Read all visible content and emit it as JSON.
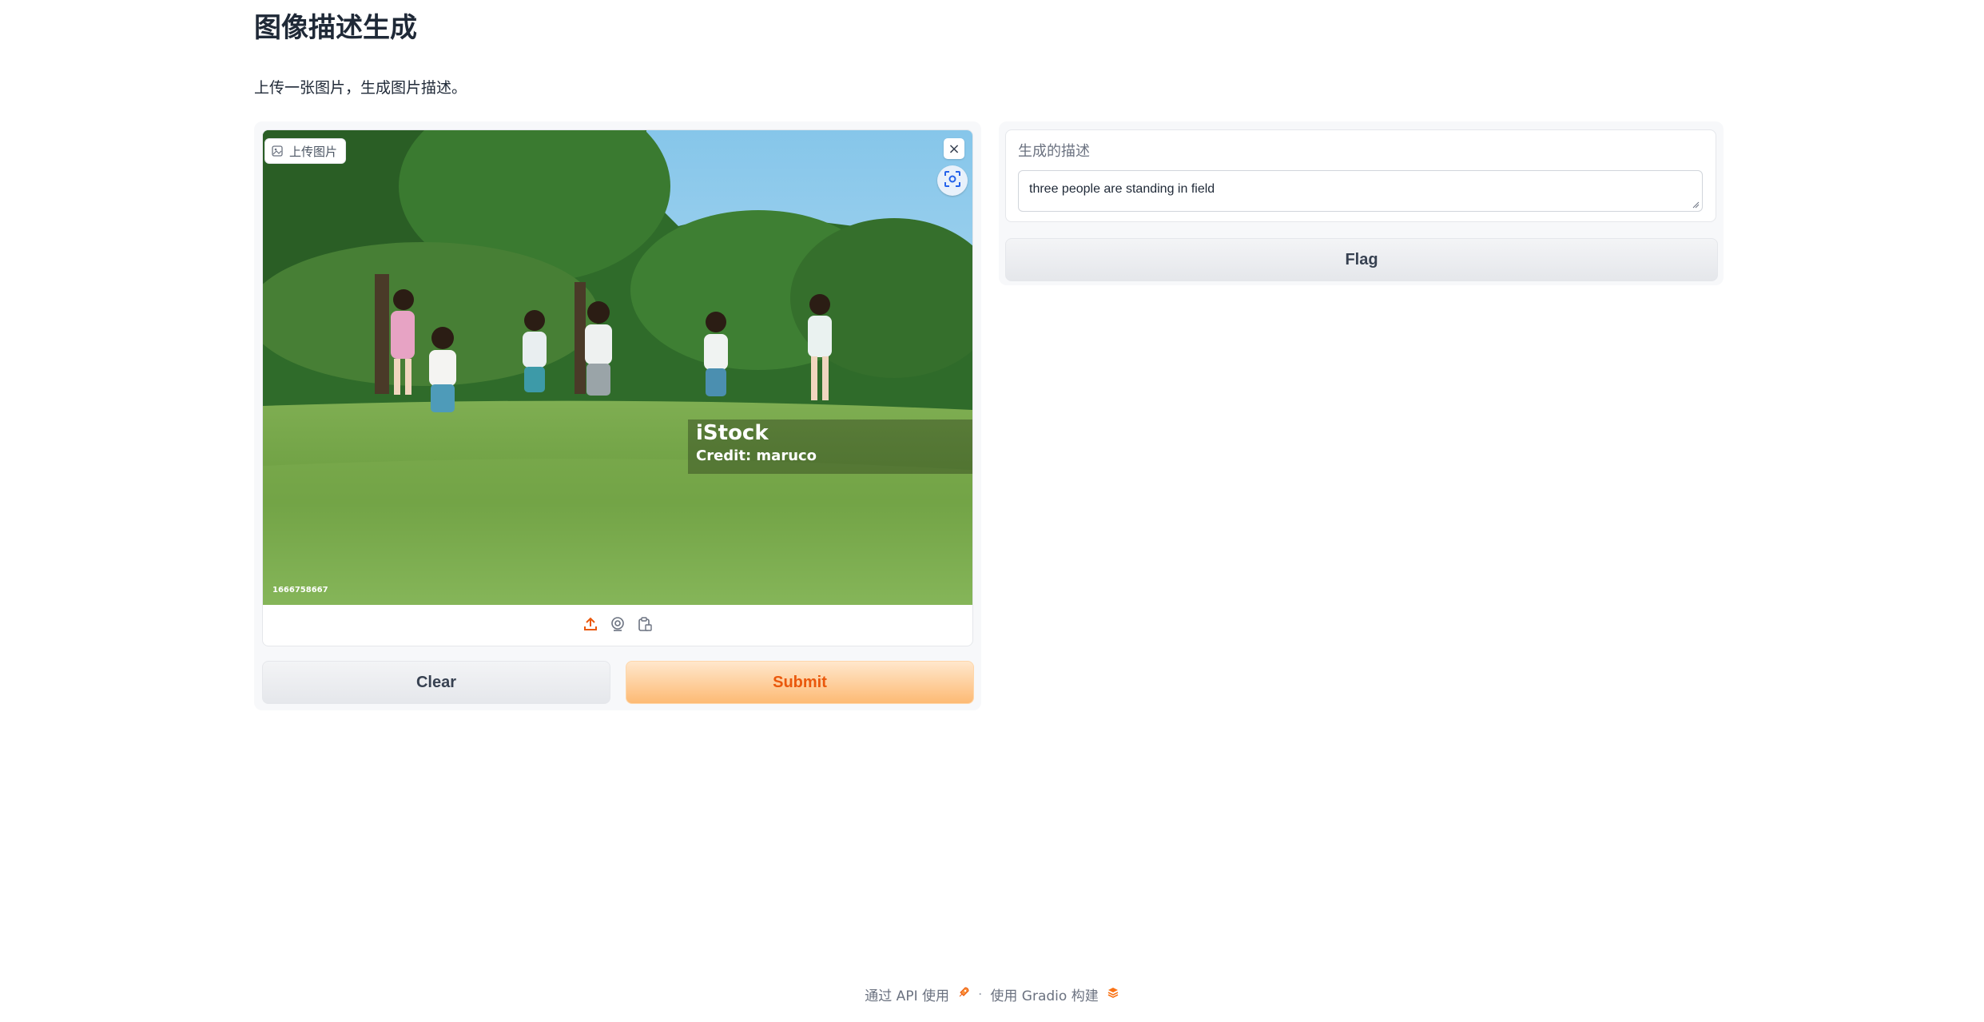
{
  "page": {
    "title": "图像描述生成",
    "description": "上传一张图片，生成图片描述。"
  },
  "input": {
    "label": "上传图片",
    "image": {
      "watermark_brand": "iStock",
      "watermark_credit": "Credit: maruco",
      "image_id": "1666758667"
    },
    "sources": [
      "upload-icon",
      "webcam-icon",
      "clipboard-icon"
    ]
  },
  "buttons": {
    "clear": "Clear",
    "submit": "Submit",
    "flag": "Flag"
  },
  "output": {
    "label": "生成的描述",
    "value": "three people are standing in field"
  },
  "footer": {
    "api_link": "通过 API 使用",
    "separator": "·",
    "built_with": "使用 Gradio 构建"
  },
  "colors": {
    "accent": "#ea580c",
    "submit_bg": "#fdba74",
    "panel_bg": "#f7f8fa"
  }
}
